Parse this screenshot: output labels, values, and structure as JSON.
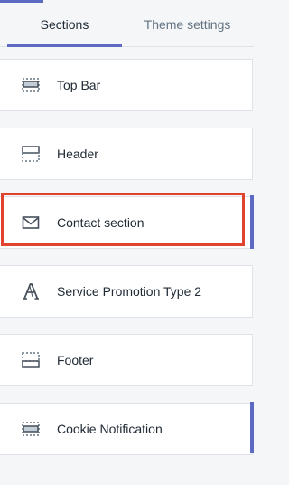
{
  "tabs": {
    "sections_label": "Sections",
    "theme_settings_label": "Theme settings"
  },
  "sections": [
    {
      "label": "Top Bar",
      "icon": "top-bar-layout-icon"
    },
    {
      "label": "Header",
      "icon": "header-layout-icon"
    },
    {
      "label": "Contact section",
      "icon": "envelope-icon"
    },
    {
      "label": "Service Promotion Type 2",
      "icon": "serif-a-text-icon"
    },
    {
      "label": "Footer",
      "icon": "footer-layout-icon"
    },
    {
      "label": "Cookie Notification",
      "icon": "notification-bar-layout-icon"
    }
  ],
  "colors": {
    "accent": "#5c6ac4",
    "highlight": "#e0442f",
    "background": "#f4f6f8"
  }
}
